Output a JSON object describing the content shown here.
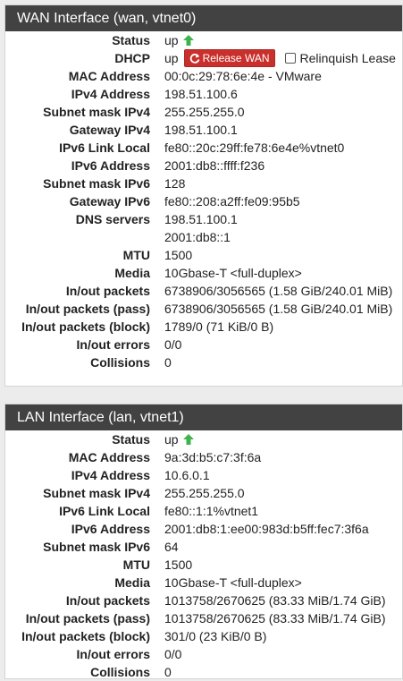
{
  "wan": {
    "title": "WAN Interface (wan, vtnet0)",
    "status": "up",
    "dhcp_value": "up",
    "release_button": "Release WAN",
    "relinquish_label": "Relinquish Lease",
    "labels": {
      "status": "Status",
      "dhcp": "DHCP",
      "mac": "MAC Address",
      "ipv4": "IPv4 Address",
      "subnet4": "Subnet mask IPv4",
      "gw4": "Gateway IPv4",
      "ll6": "IPv6 Link Local",
      "ipv6": "IPv6 Address",
      "subnet6": "Subnet mask IPv6",
      "gw6": "Gateway IPv6",
      "dns": "DNS servers",
      "mtu": "MTU",
      "media": "Media",
      "packets": "In/out packets",
      "pass": "In/out packets (pass)",
      "block": "In/out packets (block)",
      "errors": "In/out errors",
      "collisions": "Collisions"
    },
    "values": {
      "mac": "00:0c:29:78:6e:4e - VMware",
      "ipv4": "198.51.100.6",
      "subnet4": "255.255.255.0",
      "gw4": "198.51.100.1",
      "ll6": "fe80::20c:29ff:fe78:6e4e%vtnet0",
      "ipv6": "2001:db8::ffff:f236",
      "subnet6": "128",
      "gw6": "fe80::208:a2ff:fe09:95b5",
      "dns1": "198.51.100.1",
      "dns2": "2001:db8::1",
      "mtu": "1500",
      "media": "10Gbase-T <full-duplex>",
      "packets": "6738906/3056565 (1.58 GiB/240.01 MiB)",
      "pass": "6738906/3056565 (1.58 GiB/240.01 MiB)",
      "block": "1789/0 (71 KiB/0 B)",
      "errors": "0/0",
      "collisions": "0"
    }
  },
  "lan": {
    "title": "LAN Interface (lan, vtnet1)",
    "status": "up",
    "labels": {
      "status": "Status",
      "mac": "MAC Address",
      "ipv4": "IPv4 Address",
      "subnet4": "Subnet mask IPv4",
      "ll6": "IPv6 Link Local",
      "ipv6": "IPv6 Address",
      "subnet6": "Subnet mask IPv6",
      "mtu": "MTU",
      "media": "Media",
      "packets": "In/out packets",
      "pass": "In/out packets (pass)",
      "block": "In/out packets (block)",
      "errors": "In/out errors",
      "collisions": "Collisions"
    },
    "values": {
      "mac": "9a:3d:b5:c7:3f:6a",
      "ipv4": "10.6.0.1",
      "subnet4": "255.255.255.0",
      "ll6": "fe80::1:1%vtnet1",
      "ipv6": "2001:db8:1:ee00:983d:b5ff:fec7:3f6a",
      "subnet6": "64",
      "mtu": "1500",
      "media": "10Gbase-T <full-duplex>",
      "packets": "1013758/2670625 (83.33 MiB/1.74 GiB)",
      "pass": "1013758/2670625 (83.33 MiB/1.74 GiB)",
      "block": "301/0 (23 KiB/0 B)",
      "errors": "0/0",
      "collisions": "0"
    }
  },
  "icons": {
    "status_up": "arrow-up-icon",
    "release": "refresh-icon"
  },
  "colors": {
    "header_bg": "#424242",
    "status_up": "#3cb44b",
    "release_button": "#c9302c"
  }
}
